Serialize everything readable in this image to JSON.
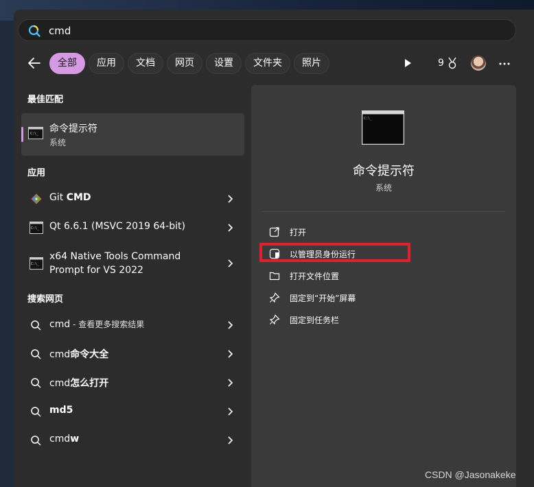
{
  "search": {
    "value": "cmd"
  },
  "filters": [
    "全部",
    "应用",
    "文档",
    "网页",
    "设置",
    "文件夹",
    "照片"
  ],
  "toolbar": {
    "reward_count": "9"
  },
  "sections": {
    "best_match": "最佳匹配",
    "apps": "应用",
    "web": "搜索网页"
  },
  "best_match": {
    "title": "命令提示符",
    "subtitle": "系统"
  },
  "apps": [
    {
      "prefix": "Git ",
      "bold": "CMD",
      "icon": "git-icon"
    },
    {
      "text": "Qt 6.6.1 (MSVC 2019 64-bit)",
      "icon": "console-icon"
    },
    {
      "line1": "x64 Native Tools Command",
      "line2": "Prompt for VS 2022",
      "icon": "console-icon"
    }
  ],
  "web": [
    {
      "prefix": "cmd",
      "rest": " - 查看更多搜索结果"
    },
    {
      "prefix": "cmd",
      "bold": "命令大全"
    },
    {
      "prefix": "cmd",
      "bold": "怎么打开"
    },
    {
      "bold": "md5"
    },
    {
      "prefix": "cmd",
      "bold": "w"
    }
  ],
  "detail": {
    "title": "命令提示符",
    "subtitle": "系统",
    "actions": [
      {
        "label": "打开",
        "icon": "open-external-icon"
      },
      {
        "label": "以管理员身份运行",
        "icon": "shield-icon"
      },
      {
        "label": "打开文件位置",
        "icon": "folder-icon"
      },
      {
        "label": "固定到“开始”屏幕",
        "icon": "pin-icon"
      },
      {
        "label": "固定到任务栏",
        "icon": "pin-icon"
      }
    ]
  },
  "watermark": "CSDN @Jasonakeke",
  "colors": {
    "accent": "#d59ae3",
    "highlight": "#e0202a"
  }
}
